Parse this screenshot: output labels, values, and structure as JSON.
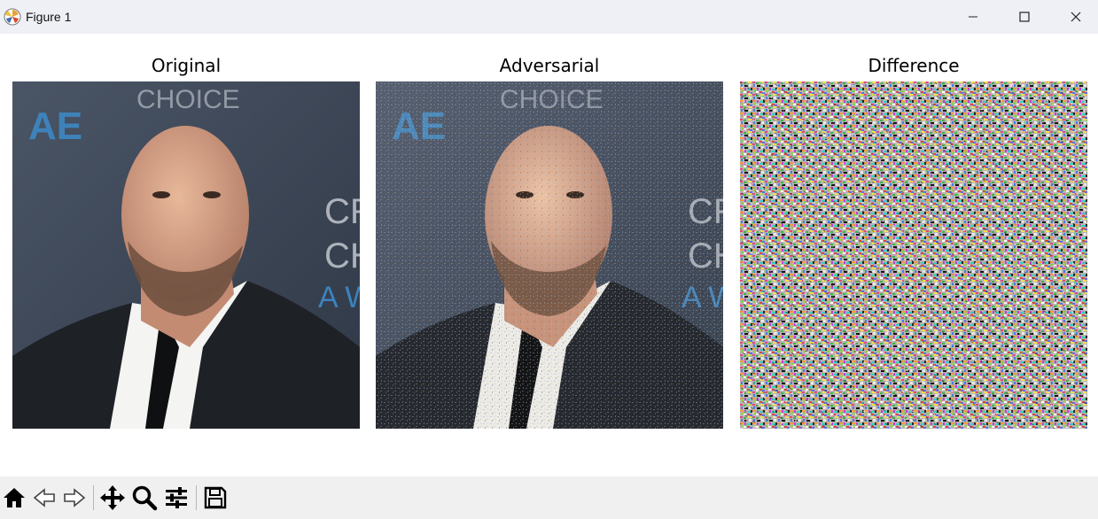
{
  "window": {
    "title": "Figure 1"
  },
  "panels": [
    {
      "title": "Original"
    },
    {
      "title": "Adversarial"
    },
    {
      "title": "Difference"
    }
  ],
  "toolbar": {
    "icons": [
      "home-icon",
      "back-icon",
      "forward-icon",
      "pan-icon",
      "zoom-icon",
      "configure-subplots-icon",
      "save-icon"
    ]
  },
  "colors": {
    "titlebar_bg": "#eef0f5",
    "toolbar_bg": "#f0f0f0",
    "photo_background": "#3b4556",
    "accent_blue": "#3d8fd1"
  }
}
